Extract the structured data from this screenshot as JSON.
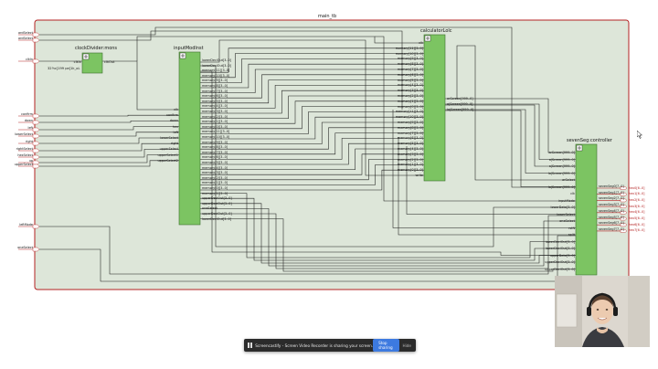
{
  "top_module": {
    "title": "main_tb"
  },
  "left_ports": {
    "names": [
      "ardSelect",
      "ardSelect",
      "clkIn",
      "confirm",
      "down",
      "left",
      "lowerSelect",
      "right",
      "rightSelect",
      "hexSelect",
      "up",
      "upperSelect",
      "leftMode",
      "oneSelect"
    ]
  },
  "clock_divider": {
    "title": "clockDivider:mons",
    "port_in": "clkIn",
    "port_out": "clkOut",
    "param": "32'hc[199  pe]1k_oL"
  },
  "input_controller": {
    "title": "inputModInst",
    "inputs": [
      "clk",
      "confirm",
      "down",
      "hex",
      "left",
      "lowerSelect",
      "right",
      "upperSelect",
      "upperSelect1",
      "upperSelect2"
    ],
    "outputs": [
      "lowerDeciOut[3..0]",
      "lowerDeciOut[3..0]",
      "memory[11][3..0]",
      "memory[10][3..0]",
      "memory[9][3..0]",
      "memory[8][3..0]",
      "memory[7][3..0]",
      "memory[6][3..0]",
      "memory[5][3..0]",
      "memory[4][3..0]",
      "memory[3][3..0]",
      "memory[2][3..0]",
      "memory[1][3..0]",
      "memory[0][3..0]",
      "memory[11][3..0]",
      "memory[10][3..0]",
      "memory[9][3..0]",
      "memory[8][3..0]",
      "memory[7][3..0]",
      "memory[6][3..0]",
      "memory[5][3..0]",
      "memory[4][3..0]",
      "memory[3][3..0]",
      "memory[2][3..0]",
      "memory[1][3..0]",
      "memory[0][3..0]",
      "memory[1][3..0]",
      "upperDeciOut[3..0]",
      "upperDeciOut[3..0]",
      "oneSelect",
      "upperDeciOut[3..0]",
      "lowerDeciOut[3..0]"
    ]
  },
  "calculator": {
    "title": "calculatorLolc",
    "inputs": [
      "clk",
      "memory[11][3..0]",
      "memory[10][3..0]",
      "memory[9][3..0]",
      "memory[8][3..0]",
      "memory[7][3..0]",
      "memory[6][3..0]",
      "memory[5][3..0]",
      "memory[4][3..0]",
      "memory[3][3..0]",
      "memory[2][3..0]",
      "memory[1][3..0]",
      "memory[0][3..0]",
      "memory[11][3..0]",
      "memory[10][3..0]",
      "memory[9][3..0]",
      "memory[8][3..0]",
      "memory[7][3..0]",
      "memory[6][3..0]",
      "memory[5][3..0]",
      "memory[4][3..0]",
      "memory[3][3..0]",
      "memory[2][3..0]",
      "memory[1][3..0]",
      "memory[0][3..0]",
      "write"
    ],
    "outputs": [
      "arScreen[999..0]",
      "a|Screen[999..0]",
      "la|Screen[999..0]"
    ]
  },
  "seven_seg": {
    "title": "sevenSeg:controller",
    "inputs": [
      "arScreen[999..0]",
      "a|Screen[999..0]",
      "a|Screen[999..0]",
      "la|Screen[999..0]",
      "arSelect",
      "la|Screen[999..0]",
      "clk",
      "inputMode",
      "lowerData[3..0]",
      "lowerSelect",
      "oneSelect",
      "rstN",
      "split",
      "lowerDeciOut[3..0]",
      "lowerDeciOut[3..0]",
      "upperData[3..0]",
      "upperDeciOut[3..0]",
      "upperDeciOut[3..0]"
    ],
    "outputs": [
      "sevenSeg0[7..0]",
      "sevenSeg1[7..0]",
      "sevenSeg2[7..0]",
      "sevenSeg3[7..0]",
      "sevenSeg4[7..0]",
      "sevenSeg5[7..0]",
      "sevenSeg6[7..0]",
      "sevenSeg7[7..0]"
    ]
  },
  "right_ports": {
    "names": [
      "hex0[6..0]",
      "hex1[6..0]",
      "hex2[6..0]",
      "hex3[6..0]",
      "hex4[6..0]",
      "hex5[6..0]",
      "hex6[6..0]",
      "hex7[6..0]"
    ]
  },
  "share_bar": {
    "message": "Screencastify - Screen Video Recorder is sharing your screen.",
    "stop_label": "Stop sharing",
    "hide_label": "Hide"
  },
  "colors": {
    "canvas_bg": "#dde6d9",
    "block_fill": "#7cc462",
    "block_stroke": "#3d6e2c",
    "wire": "#1a1a1a",
    "frame": "#b42323",
    "port_wire": "#b42323"
  }
}
